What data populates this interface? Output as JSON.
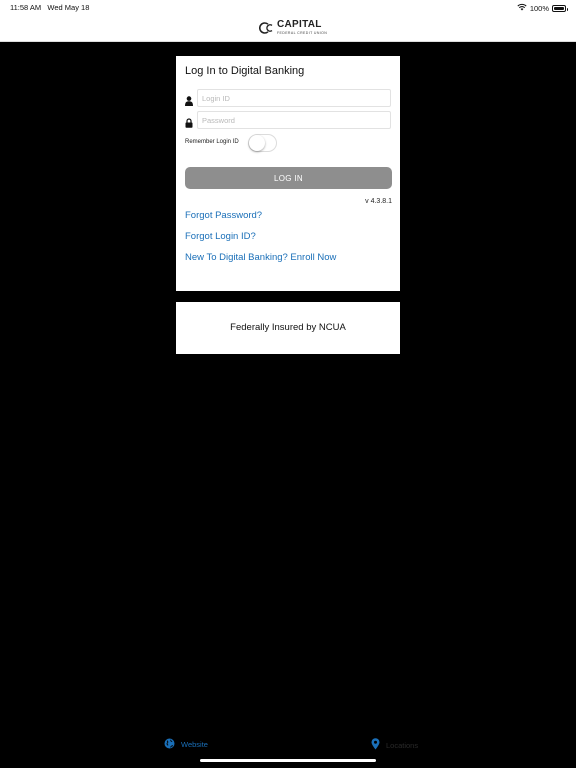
{
  "status_bar": {
    "time": "11:58 AM",
    "date": "Wed May 18",
    "battery": "100%",
    "icons": [
      "wifi-icon",
      "battery-icon"
    ]
  },
  "header": {
    "logo_text": "CAPITAL",
    "logo_subtext": "FEDERAL CREDIT UNION"
  },
  "login": {
    "title": "Log In to Digital Banking",
    "login_id_placeholder": "Login ID",
    "login_id_value": "",
    "password_placeholder": "Password",
    "password_value": "",
    "remember_label": "Remember Login ID",
    "remember_on": false,
    "login_button": "LOG IN",
    "version": "v 4.3.8.1",
    "forgot_password": "Forgot Password?",
    "forgot_login_id": "Forgot Login ID?",
    "enroll": "New To Digital Banking? Enroll Now"
  },
  "ncua": {
    "text": "Federally Insured by NCUA"
  },
  "bottom_nav": {
    "website": "Website",
    "locations": "Locations"
  },
  "colors": {
    "background": "#000000",
    "card": "#ffffff",
    "link": "#1a6fb8",
    "button_disabled": "#8e8e8e"
  }
}
